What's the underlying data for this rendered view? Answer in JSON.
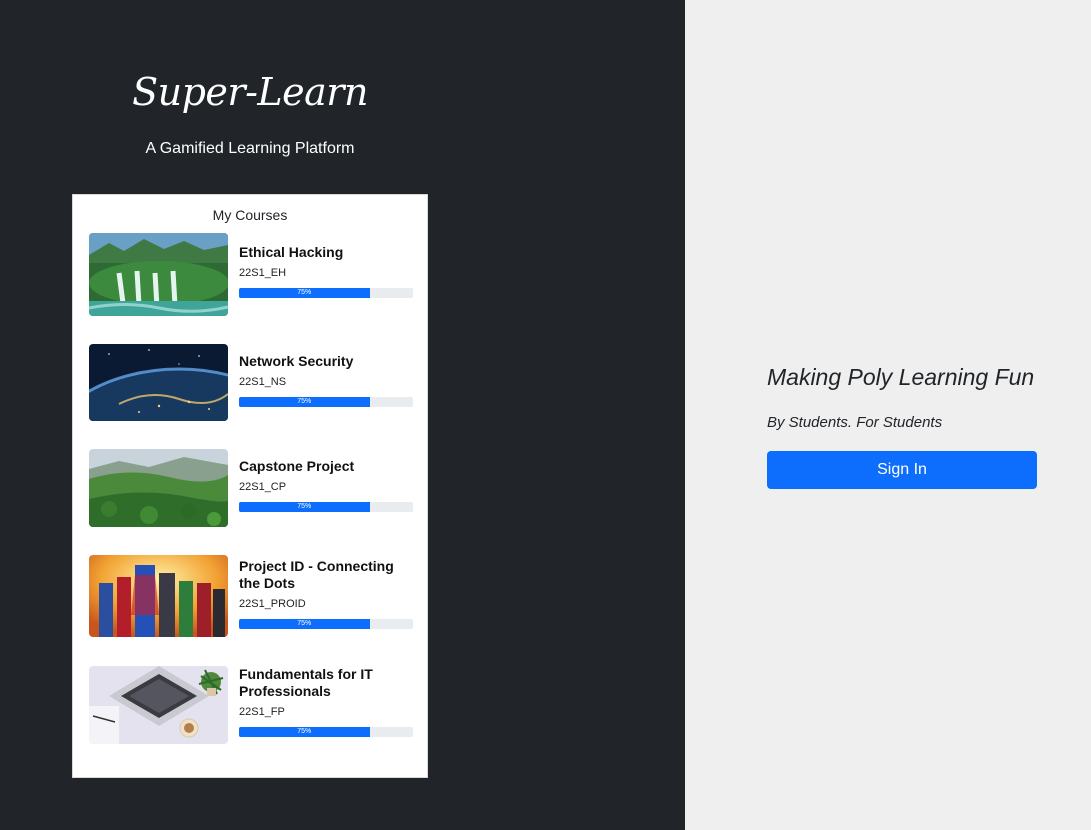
{
  "brand": {
    "title": "Super-Learn",
    "subtitle": "A Gamified Learning Platform"
  },
  "courses_panel": {
    "title": "My Courses",
    "courses": [
      {
        "name": "Ethical Hacking",
        "code": "22S1_EH",
        "progress_label": "75%",
        "progress": 0.75,
        "image": "waterfall-forest"
      },
      {
        "name": "Network Security",
        "code": "22S1_NS",
        "progress_label": "75%",
        "progress": 0.75,
        "image": "earth-from-space"
      },
      {
        "name": "Capstone Project",
        "code": "22S1_CP",
        "progress_label": "75%",
        "progress": 0.75,
        "image": "green-hills"
      },
      {
        "name": "Project ID - Connecting the Dots",
        "code": "22S1_PROID",
        "progress_label": "75%",
        "progress": 0.75,
        "image": "superheroes"
      },
      {
        "name": "Fundamentals for IT Professionals",
        "code": "22S1_FP",
        "progress_label": "75%",
        "progress": 0.75,
        "image": "laptop-desk"
      }
    ]
  },
  "hero": {
    "tagline": "Making Poly Learning Fun",
    "byline": "By Students. For Students",
    "signin_label": "Sign In"
  },
  "colors": {
    "left_bg": "#212429",
    "right_bg": "#efefef",
    "accent": "#0d6efd"
  }
}
